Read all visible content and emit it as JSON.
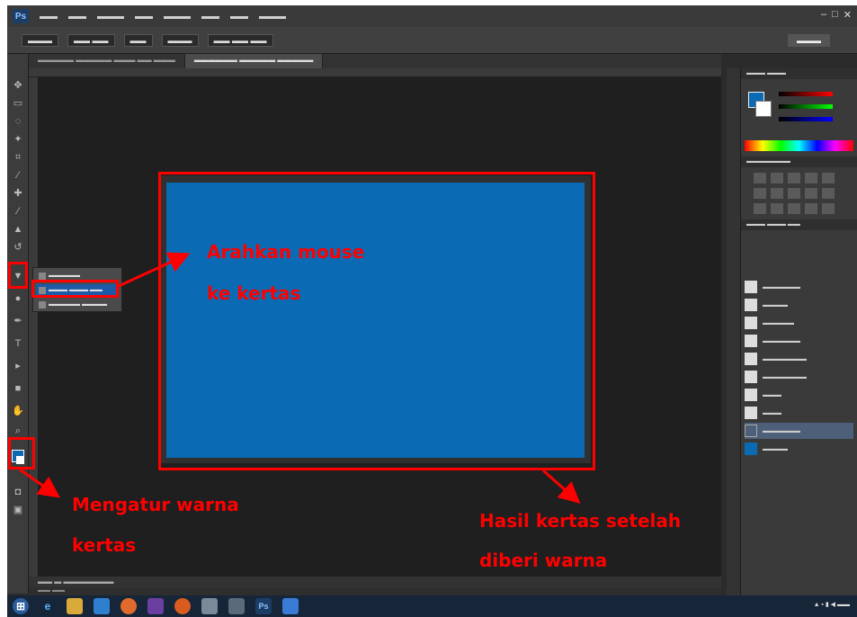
{
  "annotations": {
    "step1_line1": "Arahkan mouse",
    "step1_line2": "ke kertas",
    "step2_line1": "Mengatur warna",
    "step2_line2": "kertas",
    "step3_line1": "Hasil kertas setelah",
    "step3_line2": "diberi warna",
    "annotation_color": "#ff0000"
  },
  "document": {
    "fill_color": "#0a6bb4"
  }
}
